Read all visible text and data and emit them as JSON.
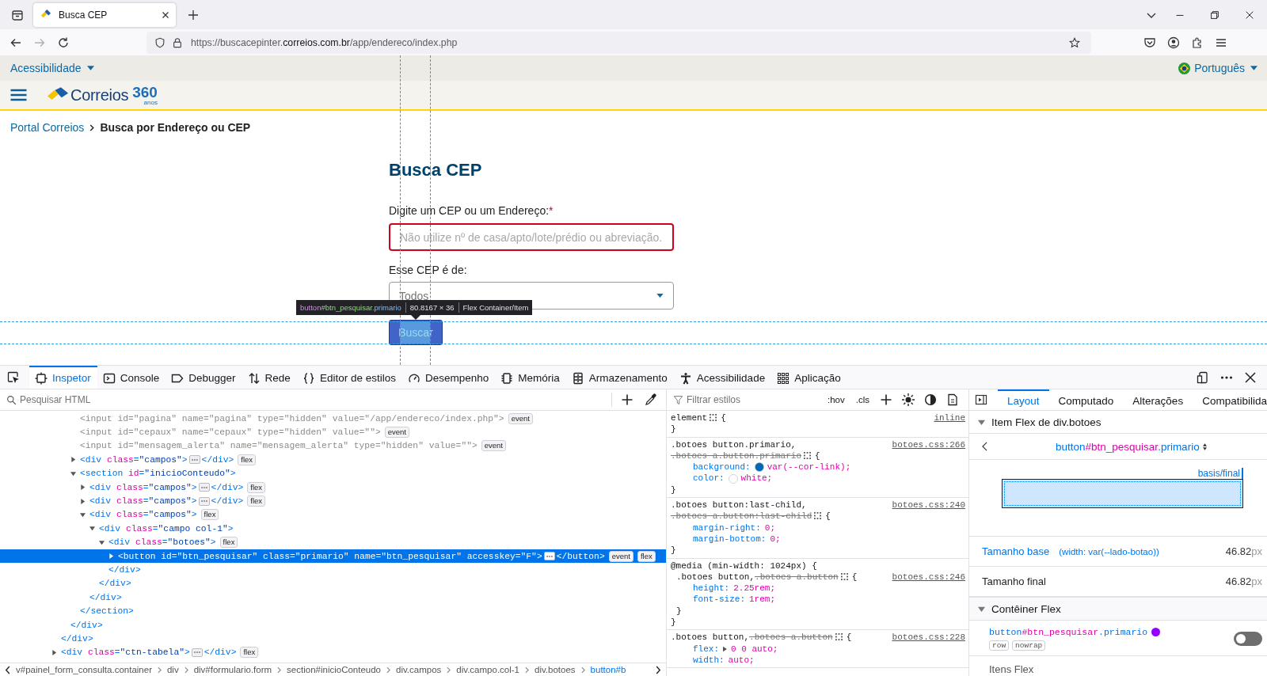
{
  "browser": {
    "tabs": [
      {
        "title": "Busca CEP",
        "selected": true
      }
    ],
    "url": {
      "prefix": "https://buscacepinter.",
      "domain": "correios.com.br",
      "path": "/app/endereco/index.php"
    },
    "forward_enabled": false
  },
  "page": {
    "accessibility_menu": "Acessibilidade",
    "language": "Português",
    "logo": {
      "name": "Correios",
      "number": "360",
      "subtitle": "anos"
    },
    "breadcrumb": [
      {
        "label": "Portal Correios",
        "current": false
      },
      {
        "label": "Busca por Endereço ou CEP",
        "current": true
      }
    ],
    "title": "Busca CEP",
    "fields": [
      {
        "kind": "text",
        "label": "Digite um CEP ou um Endereço:",
        "required": true,
        "required_mark": "*",
        "placeholder": "Não utilize nº de casa/apto/lote/prédio ou abreviação.",
        "invalid": true
      },
      {
        "kind": "select",
        "label": "Esse CEP é de:",
        "value": "Todos",
        "invalid": false
      }
    ],
    "button": {
      "label": "Buscar",
      "highlighted": true
    }
  },
  "highlighter": {
    "tag": "button",
    "id": "#btn_pesquisar",
    "class": ".primario",
    "size": "80.8167 × 36",
    "type": "Flex Container/Item"
  },
  "devtools": {
    "tabs": [
      {
        "label": "Inspetor",
        "kind": "inspector",
        "selected": true
      },
      {
        "label": "Console",
        "kind": "console",
        "selected": false
      },
      {
        "label": "Debugger",
        "kind": "debugger",
        "selected": false
      },
      {
        "label": "Rede",
        "kind": "network",
        "selected": false
      },
      {
        "label": "Editor de estilos",
        "kind": "style",
        "selected": false
      },
      {
        "label": "Desempenho",
        "kind": "performance",
        "selected": false
      },
      {
        "label": "Memória",
        "kind": "memory",
        "selected": false
      },
      {
        "label": "Armazenamento",
        "kind": "storage",
        "selected": false
      },
      {
        "label": "Acessibilidade",
        "kind": "accessibility",
        "selected": false
      },
      {
        "label": "Aplicação",
        "kind": "application",
        "selected": false
      }
    ],
    "html_search": {
      "placeholder": "Pesquisar HTML"
    },
    "html_tree": [
      {
        "close": "</div>",
        "expanded": true,
        "selected": false,
        "dimmed": false,
        "children": [
          {
            "close": "</div>",
            "expanded": true,
            "selected": false,
            "dimmed": false,
            "children": [
              {
                "open": "<input id=\"pagina\" name=\"pagina\" type=\"hidden\" value=\"/app/endereco/index.php\">",
                "badges": [
                  "event"
                ],
                "selected": false,
                "dimmed": true
              },
              {
                "open": "<input id=\"cepaux\" name=\"cepaux\" type=\"hidden\" value=\"\">",
                "badges": [
                  "event"
                ],
                "selected": false,
                "dimmed": true
              },
              {
                "open": "<input id=\"mensagem_alerta\" name=\"mensagem_alerta\" type=\"hidden\" value=\"\">",
                "badges": [
                  "event"
                ],
                "selected": false,
                "dimmed": true
              },
              {
                "open": "<div class=\"campos\">",
                "close": "</div>",
                "expanded": false,
                "badges": [
                  "flex"
                ],
                "selected": false,
                "dimmed": false
              },
              {
                "open": "<section id=\"inicioConteudo\">",
                "close": "</section>",
                "expanded": true,
                "selected": false,
                "dimmed": false,
                "children": [
                  {
                    "open": "<div class=\"campos\">",
                    "close": "</div>",
                    "expanded": false,
                    "badges": [
                      "flex"
                    ],
                    "selected": false,
                    "dimmed": false
                  },
                  {
                    "open": "<div class=\"campos\">",
                    "close": "</div>",
                    "expanded": false,
                    "badges": [
                      "flex"
                    ],
                    "selected": false,
                    "dimmed": false
                  },
                  {
                    "open": "<div class=\"campos\">",
                    "close": "</div>",
                    "expanded": true,
                    "badges": [
                      "flex"
                    ],
                    "selected": false,
                    "dimmed": false,
                    "children": [
                      {
                        "open": "<div class=\"campo col-1\">",
                        "close": "</div>",
                        "expanded": true,
                        "selected": false,
                        "dimmed": false,
                        "children": [
                          {
                            "open": "<div class=\"botoes\">",
                            "close": "</div>",
                            "expanded": true,
                            "badges": [
                              "flex"
                            ],
                            "selected": false,
                            "dimmed": false,
                            "children": [
                              {
                                "open": "<button id=\"btn_pesquisar\" class=\"primario\" name=\"btn_pesquisar\" accesskey=\"F\">",
                                "close": "</button>",
                                "expanded": false,
                                "badges": [
                                  "event",
                                  "flex"
                                ],
                                "selected": true,
                                "dimmed": false
                              }
                            ]
                          }
                        ]
                      }
                    ]
                  }
                ]
              }
            ]
          }
        ]
      },
      {
        "open": "<div class=\"ctn-tabela\">",
        "close": "</div>",
        "expanded": false,
        "badges": [
          "flex"
        ],
        "selected": false,
        "dimmed": false
      }
    ],
    "breadcrumbs": [
      {
        "label": "v#painel_form_consulta.container",
        "selected": false
      },
      {
        "label": "div",
        "selected": false
      },
      {
        "label": "div#formulario.form",
        "selected": false
      },
      {
        "label": "section#inicioConteudo",
        "selected": false
      },
      {
        "label": "div.campos",
        "selected": false
      },
      {
        "label": "div.campo.col-1",
        "selected": false
      },
      {
        "label": "div.botoes",
        "selected": false
      },
      {
        "label": "button#b",
        "selected": true
      }
    ],
    "styles_filter": {
      "placeholder": "Filtrar estilos"
    },
    "styles_buttons": [
      ":hov",
      ".cls"
    ],
    "rules": [
      {
        "selector": "element",
        "brace": "{",
        "source": "inline",
        "end": "}"
      },
      {
        "selector": ".botoes button.primario,",
        "struck": ".botoes a.button.primario",
        "brace": "{",
        "source": "botoes.css:266",
        "end": "}",
        "decls": [
          {
            "prop": "background:",
            "value": "var(--cor-link);",
            "color": "#0068b4"
          },
          {
            "prop": "color:",
            "value": "white;",
            "color": "#ffffff"
          }
        ]
      },
      {
        "selector": ".botoes button:last-child,",
        "struck": ".botoes a.button:last-child",
        "brace": "{",
        "source": "botoes.css:240",
        "end": "}",
        "decls": [
          {
            "prop": "margin-right:",
            "value": "0;"
          },
          {
            "prop": "margin-bottom:",
            "value": "0;"
          }
        ]
      },
      {
        "media": "@media (min-width: 1024px) {",
        "selector": ".botoes button,",
        "struck": ".botoes a.button",
        "brace": "{",
        "source": "botoes.css:246",
        "end": "}",
        "media_end": "}",
        "decls": [
          {
            "prop": "height:",
            "value": "2.25rem;"
          },
          {
            "prop": "font-size:",
            "value": "1rem;"
          }
        ]
      },
      {
        "selector": ".botoes button,",
        "struck": ".botoes a.button",
        "brace": "{",
        "source": "botoes.css:228",
        "decls": [
          {
            "prop": "flex:",
            "value": "0 0 auto;",
            "expandable": true
          },
          {
            "prop": "width:",
            "value": "auto;"
          }
        ]
      }
    ],
    "sidebar_tabs": [
      {
        "label": "Layout",
        "selected": true
      },
      {
        "label": "Computado",
        "selected": false
      },
      {
        "label": "Alterações",
        "selected": false
      },
      {
        "label": "Compatibilida",
        "selected": false
      }
    ],
    "flex_item": {
      "heading": "Item Flex de div.botoes",
      "expanded": true,
      "selector": {
        "tag": "button",
        "id": "#btn_pesquisar",
        "class": ".primario"
      },
      "diagram_label": "basis/final",
      "rows": [
        {
          "label": "Tamanho base",
          "note": "(width: var(--lado-botao))",
          "value": "46.82",
          "unit": "px",
          "highlighted": true
        },
        {
          "label": "Tamanho final",
          "value": "46.82",
          "unit": "px",
          "highlighted": false
        }
      ]
    },
    "flex_container": {
      "heading": "Contêiner Flex",
      "expanded": true,
      "selector": {
        "tag": "button",
        "id": "#btn_pesquisar",
        "class": ".primario"
      },
      "color": "#9400ff",
      "badges": [
        "row",
        "nowrap"
      ],
      "highlight_on": false,
      "items_heading": "Itens Flex"
    }
  }
}
